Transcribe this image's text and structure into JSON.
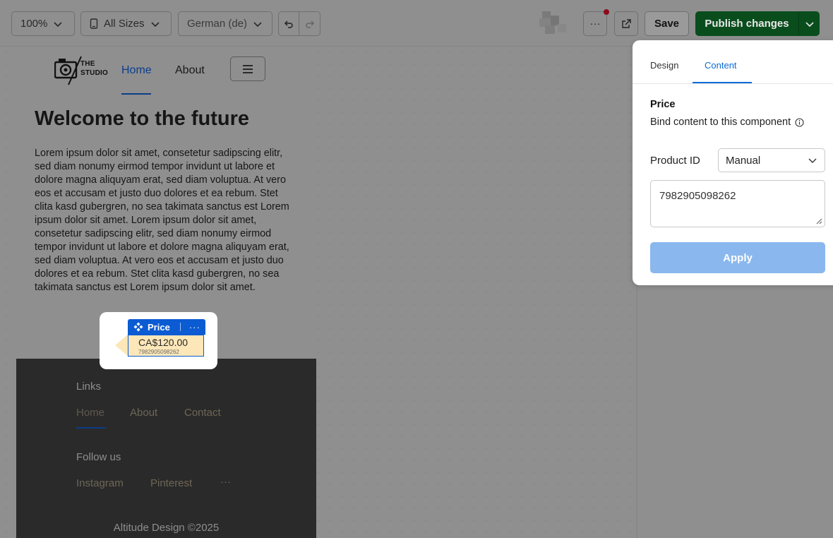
{
  "toolbar": {
    "zoom": "100%",
    "sizes": "All Sizes",
    "language": "German (de)",
    "more": "···",
    "save": "Save",
    "publish": "Publish changes"
  },
  "site": {
    "logo_line1": "THE",
    "logo_line2": "STUDIO",
    "nav": {
      "home": "Home",
      "about": "About"
    },
    "hero_title": "Welcome to the future",
    "hero_text": "Lorem ipsum dolor sit amet, consetetur sadipscing elitr, sed diam nonumy eirmod tempor invidunt ut labore et dolore magna aliquyam erat, sed diam voluptua. At vero eos et accusam et justo duo dolores et ea rebum. Stet clita kasd gubergren, no sea takimata sanctus est Lorem ipsum dolor sit amet. Lorem ipsum dolor sit amet, consetetur sadipscing elitr, sed diam nonumy eirmod tempor invidunt ut labore et dolore magna aliquyam erat, sed diam voluptua. At vero eos et accusam et justo duo dolores et ea rebum. Stet clita kasd gubergren, no sea takimata sanctus est Lorem ipsum dolor sit amet.",
    "footer": {
      "links_heading": "Links",
      "links": [
        "Home",
        "About",
        "Contact"
      ],
      "follow_heading": "Follow us",
      "social": [
        "Instagram",
        "Pinterest"
      ],
      "social_more": "···",
      "copyright": "Altitude Design ©2025"
    }
  },
  "component": {
    "tag_label": "Price",
    "tag_more": "···",
    "price_value": "CA$120.00",
    "product_id": "7982905098262"
  },
  "panel": {
    "tabs": [
      "Design",
      "Content"
    ],
    "active_tab": "Content",
    "title": "Price",
    "subtitle": "Bind content to this component",
    "product_id_label": "Product ID",
    "product_id_mode": "Manual",
    "product_id_value": "7982905098262",
    "apply": "Apply"
  },
  "colors": {
    "publish": "#0a4d1d",
    "accent": "#0b6bd6",
    "apply_disabled": "#8ab8ee",
    "notify_dot": "#8c0a1a"
  }
}
